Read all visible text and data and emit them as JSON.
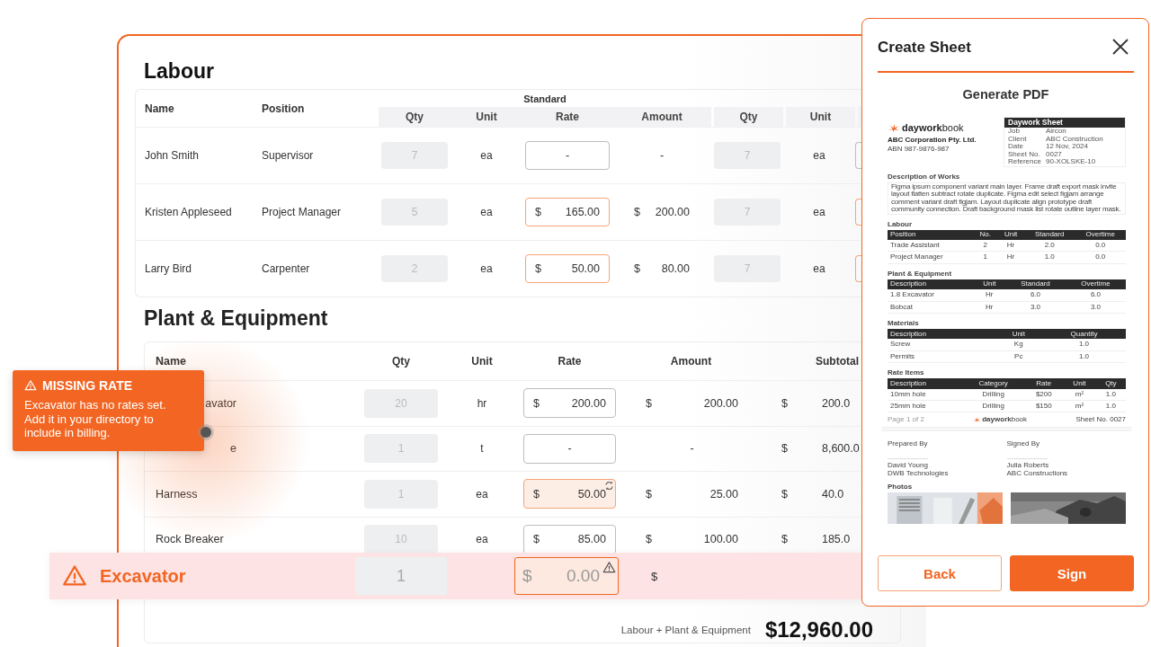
{
  "labour": {
    "title": "Labour",
    "group_header": "Standard",
    "columns": [
      "Name",
      "Position",
      "Qty",
      "Unit",
      "Rate",
      "Amount",
      "Qty",
      "Unit"
    ],
    "rows": [
      {
        "name": "John Smith",
        "position": "Supervisor",
        "qty": "7",
        "unit": "ea",
        "rate": {
          "kind": "empty",
          "value": "-"
        },
        "amount": {
          "value": "-"
        },
        "ot_qty": "7",
        "ot_unit": "ea",
        "ot_rate": {
          "kind": "empty"
        }
      },
      {
        "name": "Kristen Appleseed",
        "position": "Project Manager",
        "qty": "5",
        "unit": "ea",
        "rate": {
          "kind": "custom",
          "currency": "$",
          "value": "165.00"
        },
        "amount": {
          "currency": "$",
          "value": "200.00"
        },
        "ot_qty": "7",
        "ot_unit": "ea",
        "ot_rate": {
          "kind": "custom"
        }
      },
      {
        "name": "Larry Bird",
        "position": "Carpenter",
        "qty": "2",
        "unit": "ea",
        "rate": {
          "kind": "custom",
          "currency": "$",
          "value": "50.00"
        },
        "amount": {
          "currency": "$",
          "value": "80.00"
        },
        "ot_qty": "7",
        "ot_unit": "ea",
        "ot_rate": {
          "kind": "custom"
        }
      }
    ]
  },
  "plant": {
    "title": "Plant & Equipment",
    "columns": [
      "Name",
      "Qty",
      "Unit",
      "Rate",
      "Amount",
      "Subtotal"
    ],
    "rows": [
      {
        "name": "avator",
        "kind": "covered",
        "qty": "20",
        "unit": "hr",
        "rate": {
          "kind": "default",
          "currency": "$",
          "value": "200.00"
        },
        "amount": {
          "currency": "$",
          "value": "200.00"
        },
        "subtotal": {
          "currency": "$",
          "value": "200.0"
        }
      },
      {
        "name": "e",
        "kind": "covered",
        "qty": "1",
        "unit": "t",
        "rate": {
          "kind": "empty",
          "value": "-"
        },
        "amount": {
          "value": "-"
        },
        "subtotal": {
          "currency": "$",
          "value": "8,600.0"
        }
      },
      {
        "name": "Harness",
        "kind": "plain",
        "qty": "1",
        "unit": "ea",
        "rate": {
          "kind": "override",
          "currency": "$",
          "value": "50.00"
        },
        "amount": {
          "currency": "$",
          "value": "25.00"
        },
        "subtotal": {
          "currency": "$",
          "value": "40.0"
        }
      },
      {
        "name": "Rock Breaker",
        "kind": "plain",
        "qty": "10",
        "unit": "ea",
        "rate": {
          "kind": "default",
          "currency": "$",
          "value": "85.00"
        },
        "amount": {
          "currency": "$",
          "value": "100.00"
        },
        "subtotal": {
          "currency": "$",
          "value": "185.0"
        }
      }
    ],
    "total_label": "Labour + Plant & Equipment",
    "total": "$12,960.00"
  },
  "alert_row": {
    "name": "Excavator",
    "qty": "1",
    "currency": "$",
    "rate": "0.00",
    "amount_currency": "$"
  },
  "tooltip": {
    "title": "MISSING RATE",
    "text": "Excavator has no rates set. Add it in your directory to include in billing."
  },
  "panel": {
    "title": "Create Sheet",
    "subtitle": "Generate PDF",
    "buttons": [
      {
        "label": "Back",
        "kind": "secondary"
      },
      {
        "label": "Sign",
        "kind": "primary"
      }
    ],
    "pdf": {
      "logo": "**daywork**book",
      "company": "ABC Corporation Pty. Ltd.",
      "abn": "ABN 987-9876-987",
      "sheet_title": "Daywork Sheet",
      "fields": [
        {
          "label": "Job",
          "value": "Aircon"
        },
        {
          "label": "Client",
          "value": "ABC Construction"
        },
        {
          "label": "Date",
          "value": "12 Nov, 2024"
        },
        {
          "label": "Sheet No.",
          "value": "0027"
        },
        {
          "label": "Reference",
          "value": "90-XOLSKE-10"
        }
      ],
      "description_title": "Description of Works",
      "description": "Figma ipsum component variant main layer. Frame draft export mask invite layout flatten subtract rotate duplicate. Figma edit select figjam arrange comment variant draft figjam. Layout duplicate align prototype draft community connection. Draft background mask list rotate outline layer mask.",
      "tables": [
        {
          "title": "Labour",
          "columns": [
            "Position",
            "No.",
            "Unit",
            "Standard",
            "Overtime"
          ],
          "rows": [
            [
              "Trade Assistant",
              "2",
              "Hr",
              "2.0",
              "0.0"
            ],
            [
              "Project Manager",
              "1",
              "Hr",
              "1.0",
              "0.0"
            ]
          ]
        },
        {
          "title": "Plant & Equipment",
          "columns": [
            "Description",
            "Unit",
            "Standard",
            "Overtime"
          ],
          "rows": [
            [
              "1.8 Excavator",
              "Hr",
              "6.0",
              "6.0"
            ],
            [
              "Bobcat",
              "Hr",
              "3.0",
              "3.0"
            ]
          ]
        },
        {
          "title": "Materials",
          "columns": [
            "Description",
            "Unit",
            "Quantity"
          ],
          "rows": [
            [
              "Screw",
              "Kg",
              "1.0"
            ],
            [
              "Permits",
              "Pc",
              "1.0"
            ]
          ]
        },
        {
          "title": "Rate Items",
          "columns": [
            "Description",
            "Category",
            "Rate",
            "Unit",
            "Qty"
          ],
          "rows": [
            [
              "10mm hole",
              "Drilling",
              "$200",
              "m²",
              "1.0"
            ],
            [
              "25mm hole",
              "Drilling",
              "$150",
              "m²",
              "1.0"
            ]
          ]
        }
      ],
      "footer_page": "Page 1 of 2",
      "footer_logo": "**daywork**book",
      "footer_sheet": "Sheet No. 0027",
      "signatures": [
        {
          "label": "Prepared By",
          "name": "David Young",
          "company": "DWB Technologies"
        },
        {
          "label": "Signed By",
          "name": "Julia Roberts",
          "company": "ABC Constructions"
        }
      ],
      "photos_title": "Photos"
    }
  }
}
